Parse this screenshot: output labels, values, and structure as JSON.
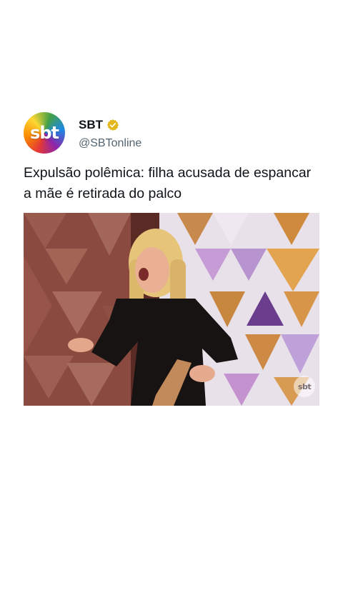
{
  "account": {
    "display_name": "SBT",
    "handle": "@SBTonline",
    "avatar_text": "sbt",
    "verified_icon": "verified-badge-icon",
    "verified_color": "#e2b719"
  },
  "tweet": {
    "text": "Expulsão polêmica: filha acusada de espancar a mãe é retirada do palco"
  },
  "media": {
    "watermark_text": "sbt"
  },
  "colors": {
    "text_primary": "#0f1419",
    "text_secondary": "#536471",
    "background": "#ffffff"
  }
}
